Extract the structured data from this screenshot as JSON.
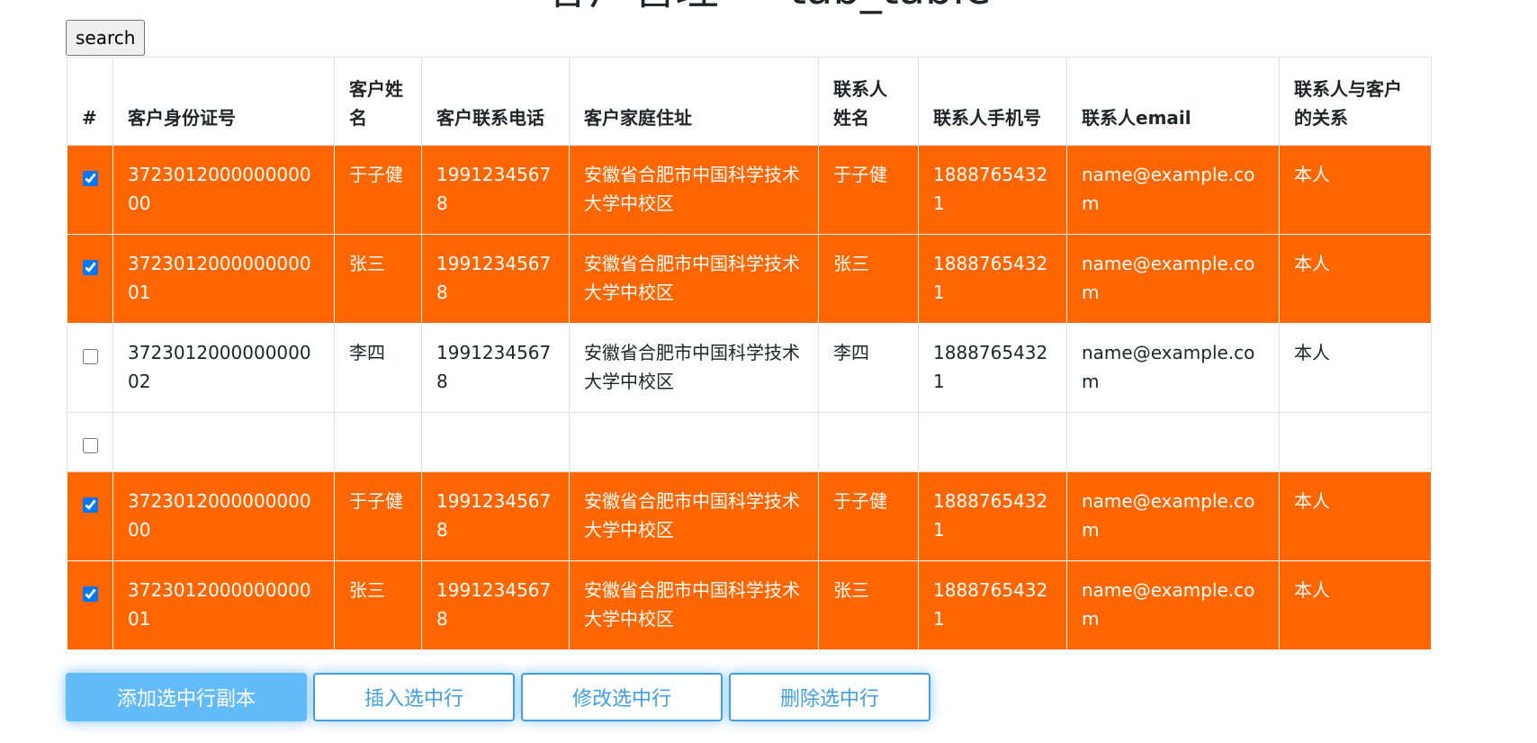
{
  "page": {
    "title": "客户管理 — tab_table"
  },
  "search": {
    "label": "search"
  },
  "table": {
    "columns": [
      "#",
      "客户身份证号",
      "客户姓名",
      "客户联系电话",
      "客户家庭住址",
      "联系人姓名",
      "联系人手机号",
      "联系人email",
      "联系人与客户的关系"
    ],
    "rows": [
      {
        "checked": true,
        "selected": true,
        "id_card": "372301200000000000",
        "name": "于子健",
        "phone": "19912345678",
        "address": "安徽省合肥市中国科学技术大学中校区",
        "contact_name": "于子健",
        "contact_phone": "18887654321",
        "contact_email": "name@example.com",
        "relation": "本人"
      },
      {
        "checked": true,
        "selected": true,
        "id_card": "372301200000000001",
        "name": "张三",
        "phone": "19912345678",
        "address": "安徽省合肥市中国科学技术大学中校区",
        "contact_name": "张三",
        "contact_phone": "18887654321",
        "contact_email": "name@example.com",
        "relation": "本人"
      },
      {
        "checked": false,
        "selected": false,
        "id_card": "372301200000000002",
        "name": "李四",
        "phone": "19912345678",
        "address": "安徽省合肥市中国科学技术大学中校区",
        "contact_name": "李四",
        "contact_phone": "18887654321",
        "contact_email": "name@example.com",
        "relation": "本人"
      },
      {
        "checked": false,
        "selected": false,
        "empty": true,
        "id_card": "",
        "name": "",
        "phone": "",
        "address": "",
        "contact_name": "",
        "contact_phone": "",
        "contact_email": "",
        "relation": ""
      },
      {
        "checked": true,
        "selected": true,
        "id_card": "372301200000000000",
        "name": "于子健",
        "phone": "19912345678",
        "address": "安徽省合肥市中国科学技术大学中校区",
        "contact_name": "于子健",
        "contact_phone": "18887654321",
        "contact_email": "name@example.com",
        "relation": "本人"
      },
      {
        "checked": true,
        "selected": true,
        "id_card": "372301200000000001",
        "name": "张三",
        "phone": "19912345678",
        "address": "安徽省合肥市中国科学技术大学中校区",
        "contact_name": "张三",
        "contact_phone": "18887654321",
        "contact_email": "name@example.com",
        "relation": "本人"
      }
    ]
  },
  "actions": {
    "add_copy": "添加选中行副本",
    "insert": "插入选中行",
    "modify": "修改选中行",
    "delete": "删除选中行"
  },
  "colors": {
    "selected_row_bg": "#ff6600",
    "primary_button": "#64bbfa",
    "outline_button": "#409ee3"
  }
}
